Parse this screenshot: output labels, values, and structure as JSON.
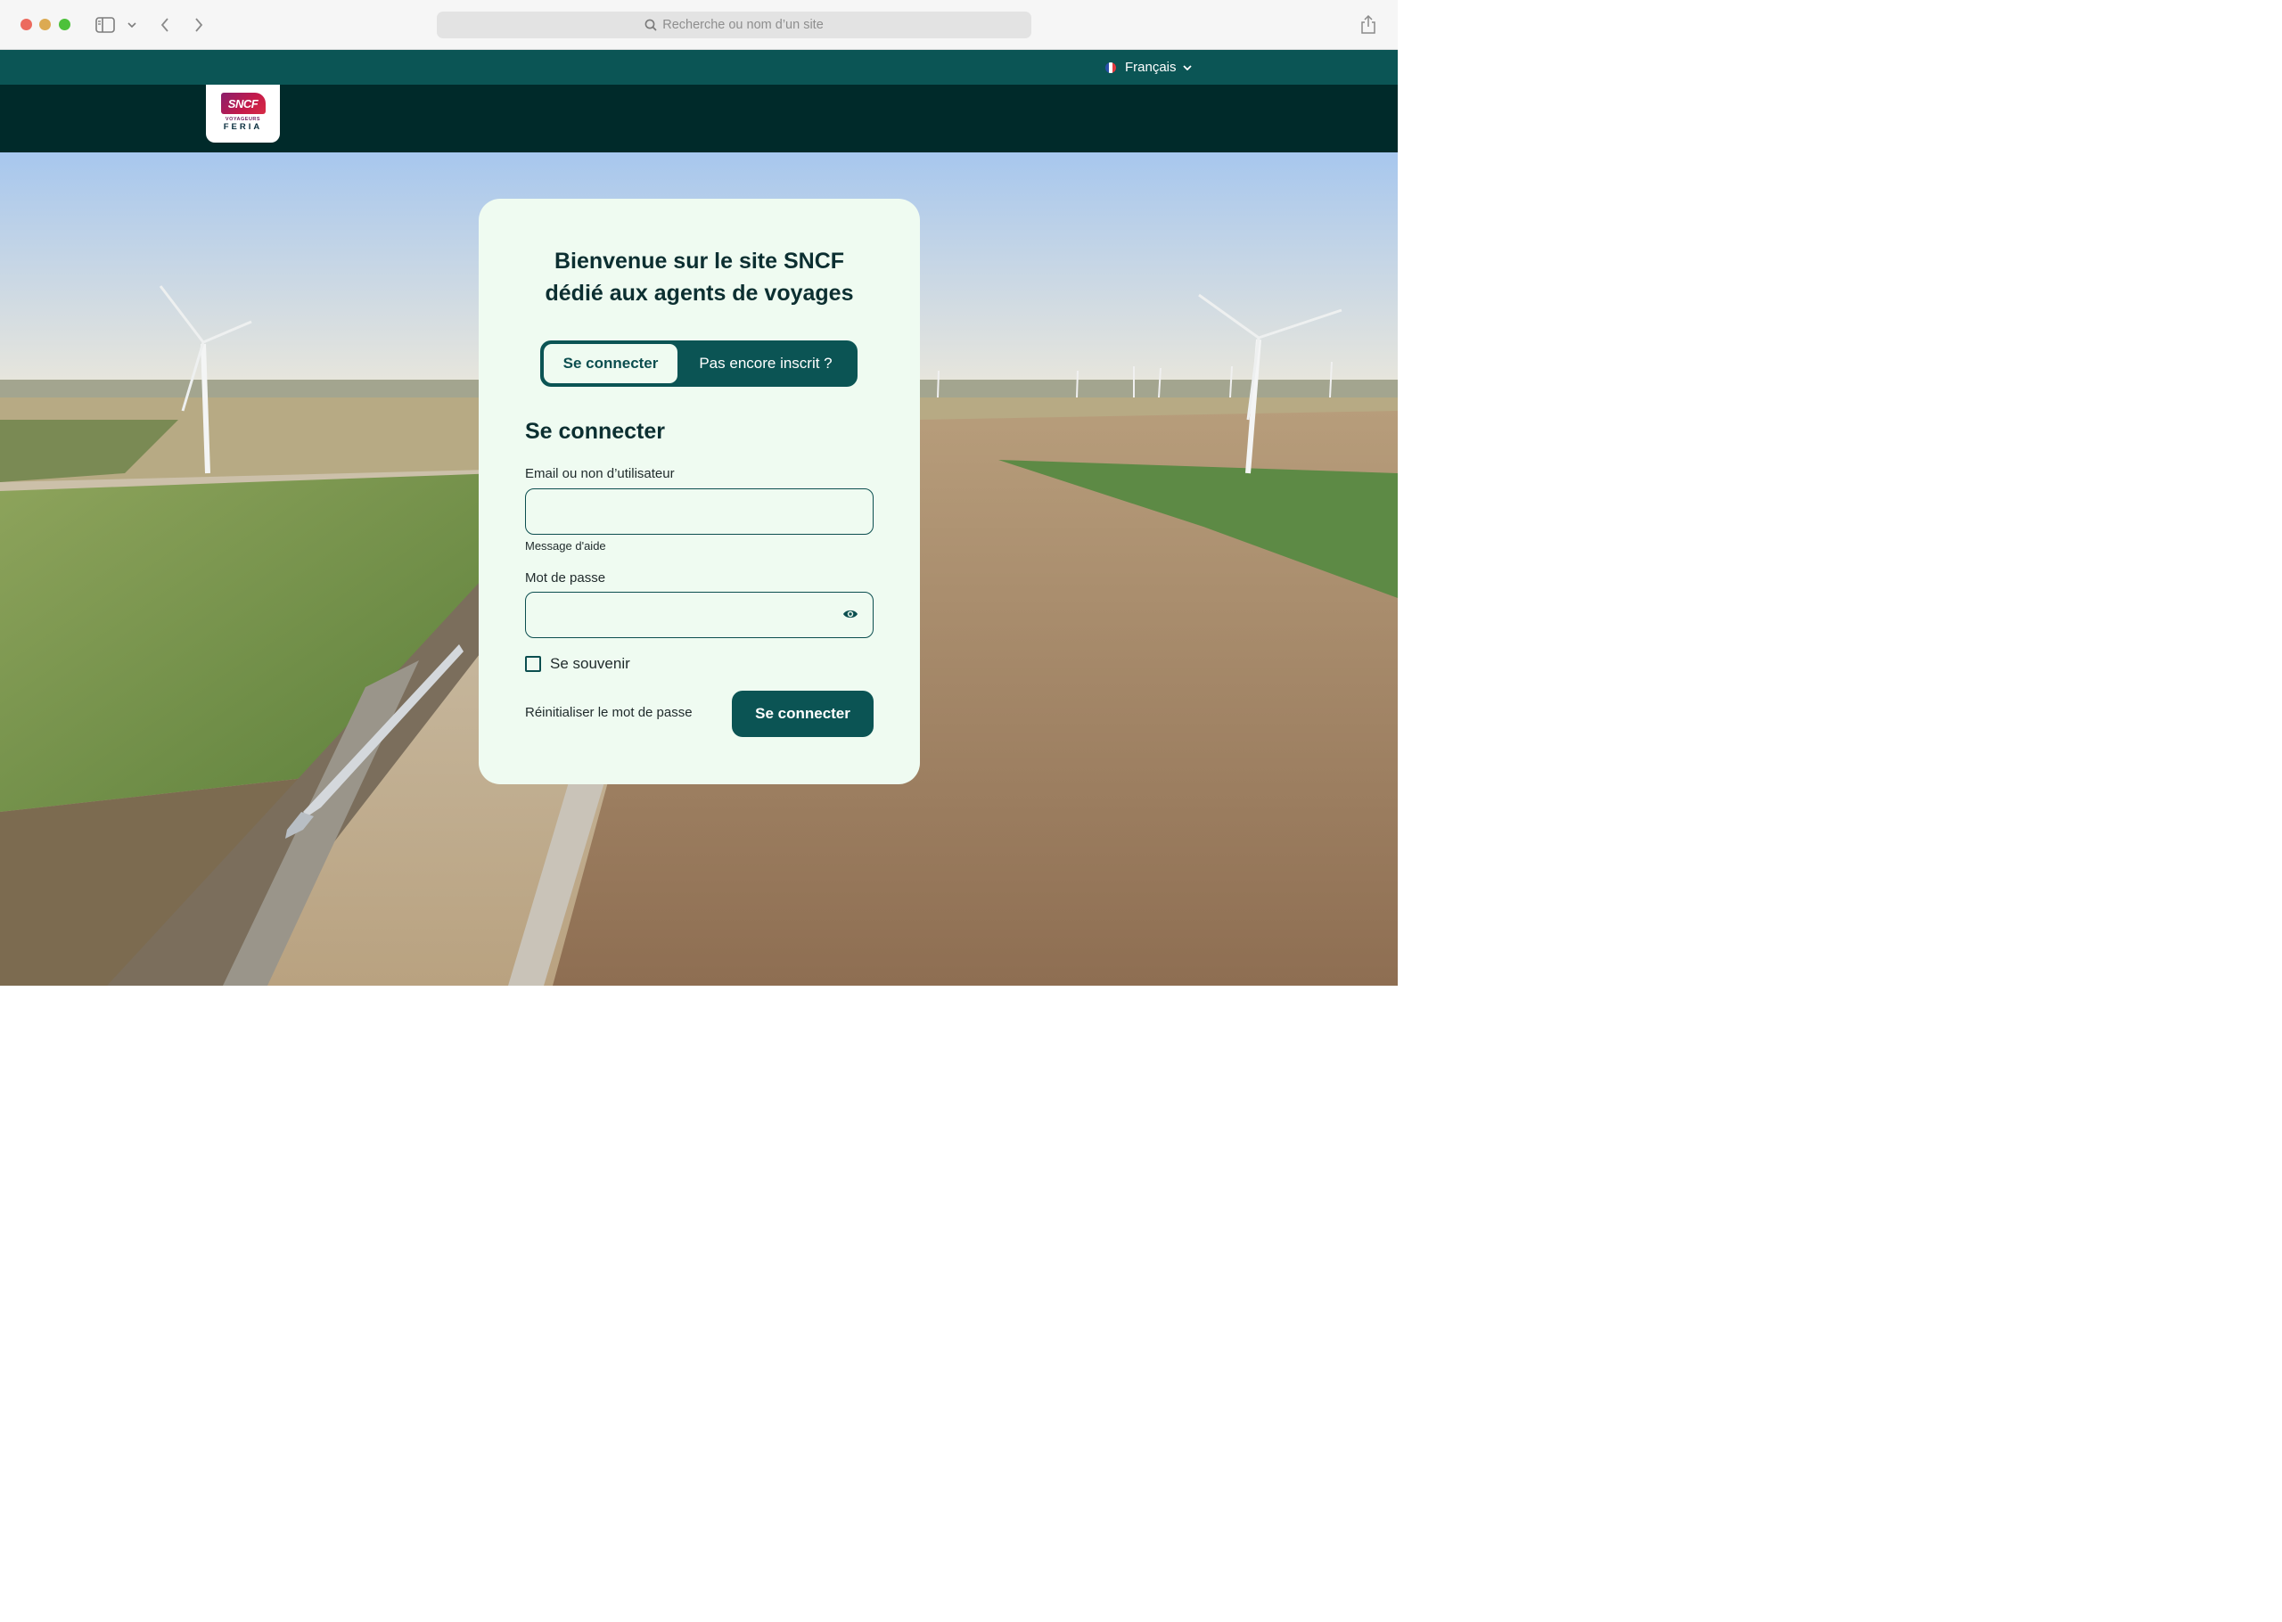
{
  "browser": {
    "address_placeholder": "Recherche ou nom d’un site",
    "icons": [
      "sidebar-icon",
      "chevron-down-icon",
      "back-arrow-icon",
      "forward-arrow-icon",
      "search-icon",
      "share-icon"
    ]
  },
  "header": {
    "language": "Français",
    "logo": {
      "mark": "SNCF",
      "subtitle": "VOYAGEURS",
      "name": "FERIA"
    }
  },
  "login": {
    "title_line1": "Bienvenue sur le site SNCF",
    "title_line2": "dédié aux agents de voyages",
    "tabs": [
      {
        "label": "Se connecter",
        "active": true
      },
      {
        "label": "Pas encore inscrit ?",
        "active": false
      }
    ],
    "section_title": "Se connecter",
    "email_label": "Email ou non d’utilisateur",
    "email_value": "",
    "email_helper": "Message d'aide",
    "password_label": "Mot de passe",
    "password_value": "",
    "remember_label": "Se souvenir",
    "remember_checked": false,
    "reset_link": "Réinitialiser le mot de passe",
    "submit_label": "Se connecter"
  },
  "colors": {
    "lang_bar": "#0b5555",
    "brand_bar": "#002a2a",
    "card_bg": "#effbf1",
    "primary": "#0b5454",
    "title_text": "#0c2f31"
  }
}
